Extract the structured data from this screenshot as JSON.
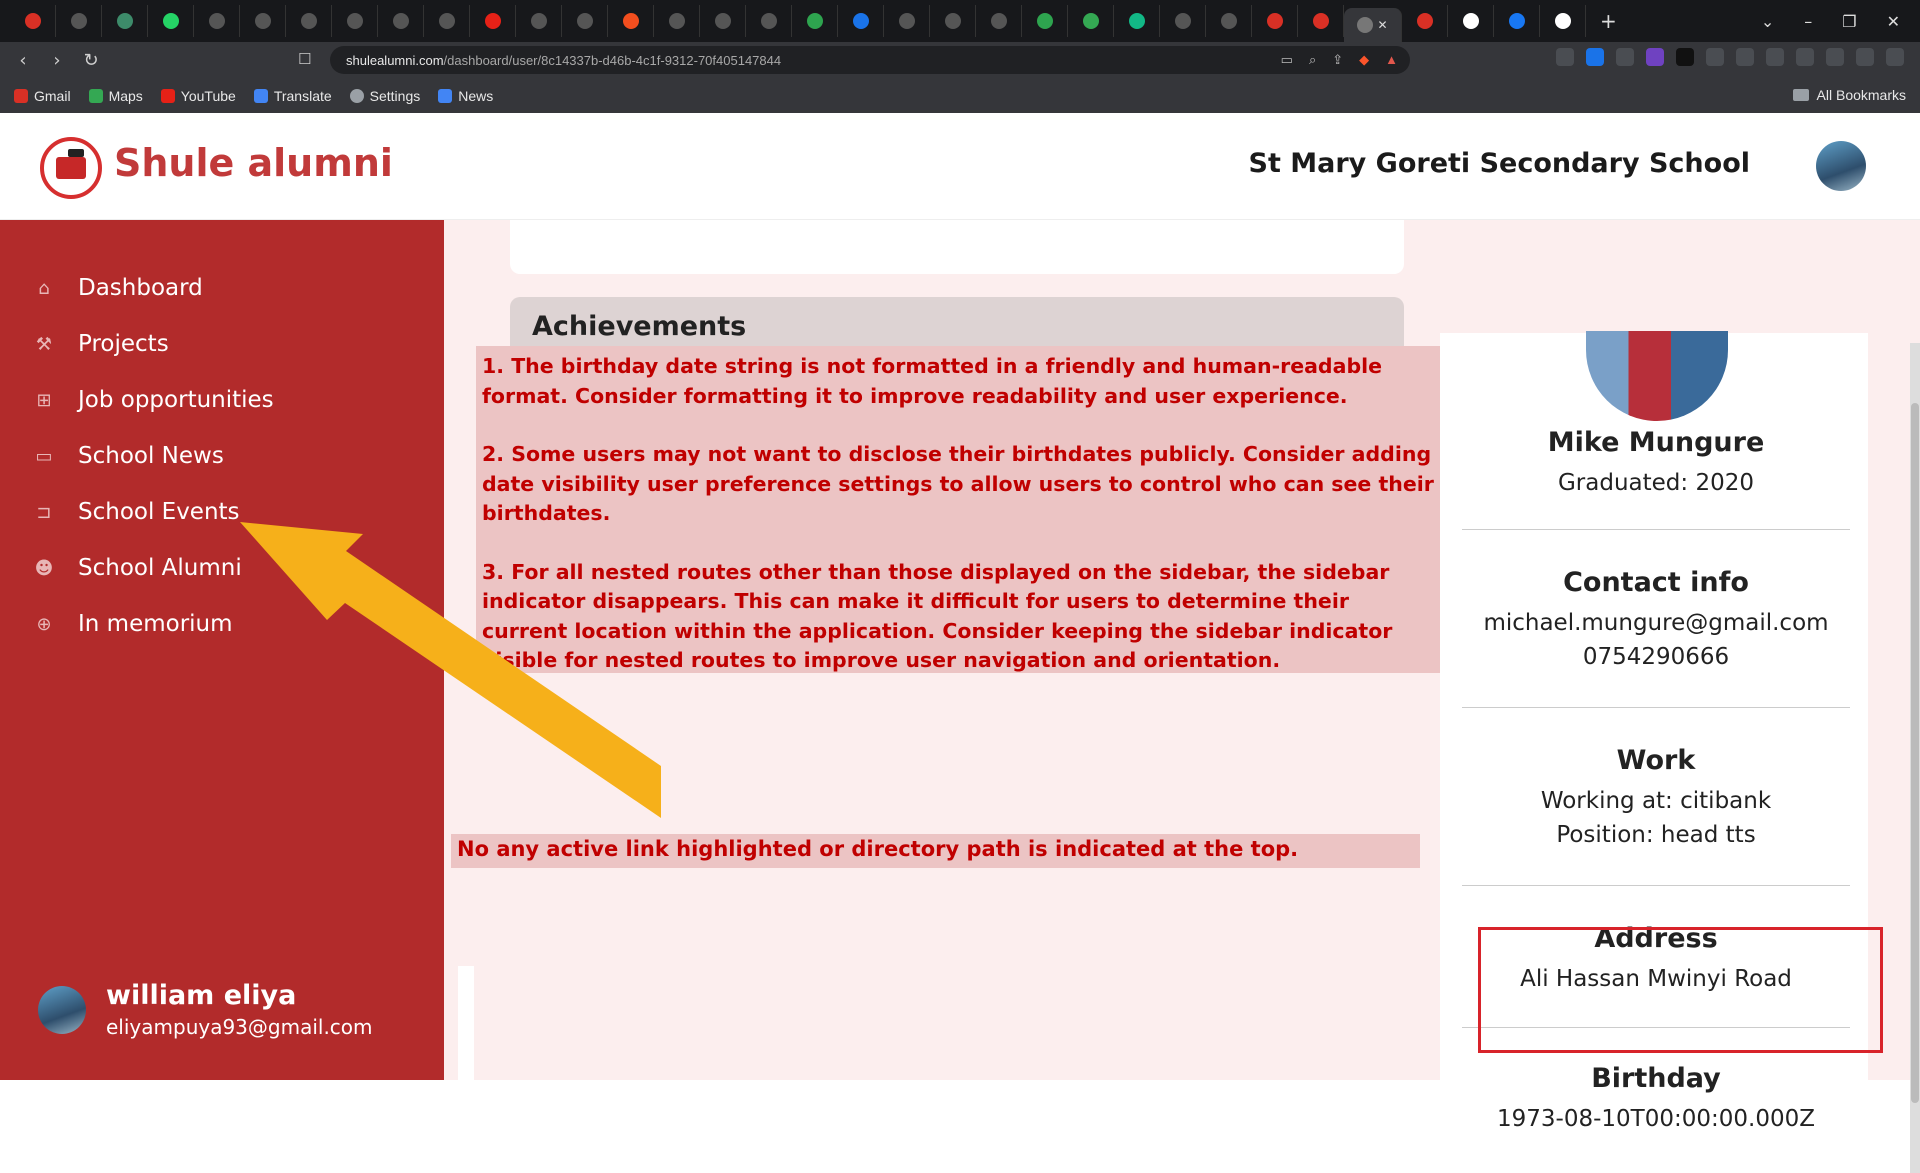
{
  "browser": {
    "url_host": "shulealumni.com",
    "url_path": "/dashboard/user/8c14337b-d46b-4c1f-9312-70f405147844",
    "bookmarks": [
      "Gmail",
      "Maps",
      "YouTube",
      "Translate",
      "Settings",
      "News"
    ],
    "all_bookmarks": "All Bookmarks"
  },
  "header": {
    "brand": "Shule alumni",
    "school": "St Mary Goreti Secondary School"
  },
  "sidebar": {
    "items": [
      {
        "label": "Dashboard",
        "icon": "home-icon"
      },
      {
        "label": "Projects",
        "icon": "hammer-icon"
      },
      {
        "label": "Job opportunities",
        "icon": "sitemap-icon"
      },
      {
        "label": "School News",
        "icon": "monitor-icon"
      },
      {
        "label": "School Events",
        "icon": "events-icon"
      },
      {
        "label": "School Alumni",
        "icon": "users-icon"
      },
      {
        "label": "In memorium",
        "icon": "plus-circle-icon"
      }
    ],
    "user": {
      "name": "william eliya",
      "email": "eliyampuya93@gmail.com"
    }
  },
  "main": {
    "achievements_title": "Achievements",
    "notes": [
      "1. The birthday date string is not formatted in a friendly and human-readable format. Consider formatting it to improve readability and user experience.",
      "2. Some users may not want to disclose their birthdates publicly. Consider adding date visibility user preference settings to allow users to control who can see their birthdates.",
      "3. For all nested routes other than those displayed on the sidebar, the sidebar indicator disappears. This can make it difficult for users to determine their current location within the application. Consider keeping the sidebar indicator visible for nested routes to improve user navigation and orientation."
    ],
    "note_bottom": "No any active link highlighted or directory path is indicated at the top."
  },
  "profile": {
    "name": "Mike Mungure",
    "graduated": "Graduated: 2020",
    "contact_title": "Contact info",
    "email": "michael.mungure@gmail.com",
    "phone": "0754290666",
    "work_title": "Work",
    "working_at": "Working at: citibank",
    "position": "Position: head tts",
    "address_title": "Address",
    "address": "Ali Hassan Mwinyi Road",
    "birthday_title": "Birthday",
    "birthday": "1973-08-10T00:00:00.000Z"
  },
  "colors": {
    "sidebar": "#b22b2b",
    "brand": "#c13a3a",
    "note_text": "#c00000",
    "arrow": "#f6b01a"
  }
}
